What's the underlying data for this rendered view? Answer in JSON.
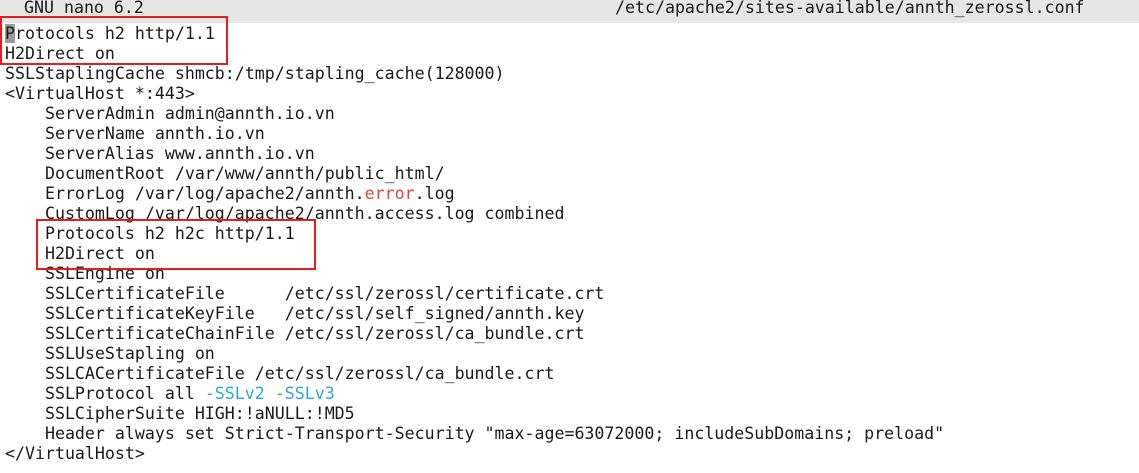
{
  "titlebar": {
    "app": "GNU nano 6.2",
    "path": "/etc/apache2/sites-available/annth_zerossl.conf"
  },
  "editor": {
    "cursor_char": "P",
    "lines": [
      {
        "text": "rotocols h2 http/1.1",
        "indent": ""
      },
      {
        "text": "H2Direct on"
      },
      {
        "text": "SSLStaplingCache shmcb:/tmp/stapling_cache(128000)"
      },
      {
        "text": "<VirtualHost *:443>"
      },
      {
        "text": "    ServerAdmin admin@annth.io.vn"
      },
      {
        "text": "    ServerName annth.io.vn"
      },
      {
        "text": "    ServerAlias www.annth.io.vn"
      },
      {
        "text": "    DocumentRoot /var/www/annth/public_html/"
      },
      {
        "pre": "    ErrorLog /var/log/apache2/annth.",
        "red": "error",
        "post": ".log"
      },
      {
        "text": "    CustomLog /var/log/apache2/annth.access.log combined"
      },
      {
        "text": "    Protocols h2 h2c http/1.1"
      },
      {
        "text": "    H2Direct on"
      },
      {
        "text": "    SSLEngine on"
      },
      {
        "text": "    SSLCertificateFile      /etc/ssl/zerossl/certificate.crt"
      },
      {
        "text": "    SSLCertificateKeyFile   /etc/ssl/self_signed/annth.key"
      },
      {
        "text": "    SSLCertificateChainFile /etc/ssl/zerossl/ca_bundle.crt"
      },
      {
        "text": "    SSLUseStapling on"
      },
      {
        "text": "    SSLCACertificateFile /etc/ssl/zerossl/ca_bundle.crt"
      },
      {
        "pre": "    SSLProtocol all ",
        "cyan": "-SSLv2 -SSLv3"
      },
      {
        "text": "    SSLCipherSuite HIGH:!aNULL:!MD5"
      },
      {
        "text": "    Header always set Strict-Transport-Security \"max-age=63072000; includeSubDomains; preload\""
      },
      {
        "text": "</VirtualHost>"
      }
    ]
  },
  "colors": {
    "titlebar_bg": "#e6e6e6",
    "annotation_box": "#e0201f",
    "syntax_red": "#e0443e",
    "syntax_cyan": "#2aa7d6"
  }
}
